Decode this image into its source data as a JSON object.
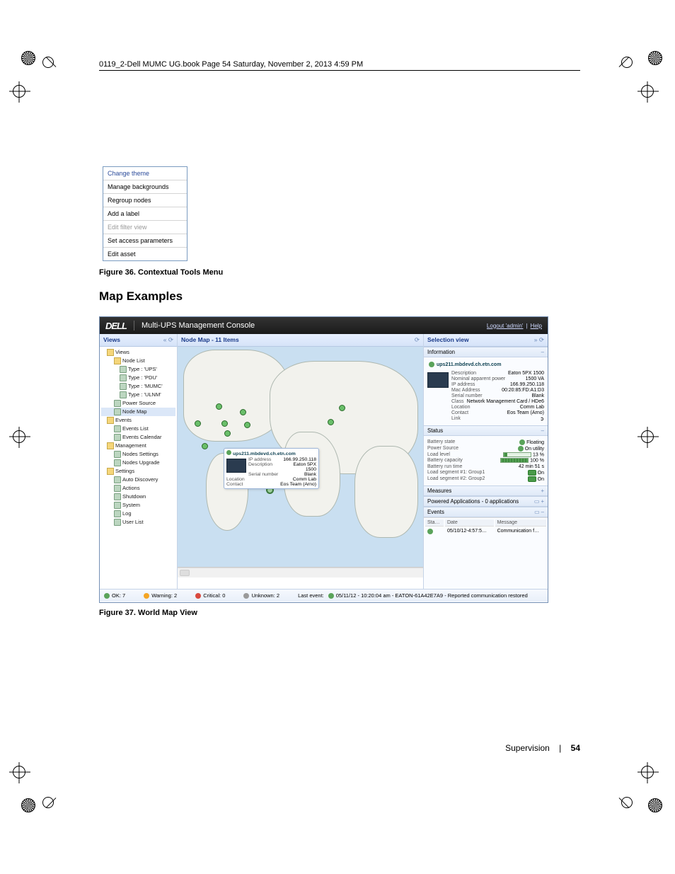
{
  "header_line": "0119_2-Dell MUMC UG.book  Page 54  Saturday, November 2, 2013  4:59 PM",
  "ctx_menu": {
    "items": [
      "Change theme",
      "Manage backgrounds",
      "Regroup nodes",
      "Add a label",
      "Edit filter view",
      "Set access parameters",
      "Edit asset"
    ],
    "caption": "Figure 36.  Contextual Tools Menu"
  },
  "heading": "Map Examples",
  "console": {
    "brand": "DELL",
    "title": "Multi-UPS Management Console",
    "logout": "Logout 'admin'",
    "help": "Help",
    "views_head": "Views",
    "tree": [
      {
        "cls": "i1 node",
        "t": "Views"
      },
      {
        "cls": "i2 node",
        "t": "Node List"
      },
      {
        "cls": "i3 leaf",
        "t": "Type : 'UPS'"
      },
      {
        "cls": "i3 leaf",
        "t": "Type : 'PDU'"
      },
      {
        "cls": "i3 leaf",
        "t": "Type : 'MUMC'"
      },
      {
        "cls": "i3 leaf",
        "t": "Type : 'ULNM'"
      },
      {
        "cls": "i2 leaf",
        "t": "Power Source"
      },
      {
        "cls": "i2 leaf sel",
        "t": "Node Map"
      },
      {
        "cls": "i1 node",
        "t": "Events"
      },
      {
        "cls": "i2 leaf",
        "t": "Events List"
      },
      {
        "cls": "i2 leaf",
        "t": "Events Calendar"
      },
      {
        "cls": "i1 node",
        "t": "Management"
      },
      {
        "cls": "i2 leaf",
        "t": "Nodes Settings"
      },
      {
        "cls": "i2 leaf",
        "t": "Nodes Upgrade"
      },
      {
        "cls": "i1 node",
        "t": "Settings"
      },
      {
        "cls": "i2 leaf",
        "t": "Auto Discovery"
      },
      {
        "cls": "i2 leaf",
        "t": "Actions"
      },
      {
        "cls": "i2 leaf",
        "t": "Shutdown"
      },
      {
        "cls": "i2 leaf",
        "t": "System"
      },
      {
        "cls": "i2 leaf",
        "t": "Log"
      },
      {
        "cls": "i2 leaf",
        "t": "User List"
      }
    ],
    "center_head": "Node Map - 11 Items",
    "popup": {
      "title": "ups211.mbdevd.ch.etn.com",
      "rows": [
        {
          "k": "IP address",
          "v": "166.99.250.118"
        },
        {
          "k": "Description",
          "v": "Eaton 5PX 1500"
        },
        {
          "k": "Serial number",
          "v": "Blank"
        },
        {
          "k": "Location",
          "v": "Comm Lab"
        },
        {
          "k": "Contact",
          "v": "Eos Team (Arno)"
        }
      ]
    },
    "selection_head": "Selection view",
    "info_head": "Information",
    "info_title": "ups211.mbdevd.ch.etn.com",
    "info_rows": [
      {
        "k": "Description",
        "v": "Eaton 5PX 1500"
      },
      {
        "k": "Nominal apparent power",
        "v": "1500 VA"
      },
      {
        "k": "IP address",
        "v": "166.99.250.118"
      },
      {
        "k": "Mac Address",
        "v": "00:20:85:FD:A1:D3"
      },
      {
        "k": "Serial number",
        "v": "Blank"
      },
      {
        "k": "Class",
        "v": "Network Management Card / HDe6"
      },
      {
        "k": "Location",
        "v": "Comm Lab"
      },
      {
        "k": "Contact",
        "v": "Eos Team (Arno)"
      },
      {
        "k": "Link",
        "v": "➲"
      }
    ],
    "status_head": "Status",
    "status_rows": [
      {
        "k": "Battery state",
        "v": "Floating",
        "icon": "dot"
      },
      {
        "k": "Power Source",
        "v": "On utility",
        "icon": "dot"
      },
      {
        "k": "Load level",
        "v": "13 %",
        "bar": 13
      },
      {
        "k": "Battery capacity",
        "v": "100 %",
        "bar": 100
      },
      {
        "k": "Battery run time",
        "v": "42 min 51 s"
      },
      {
        "k": "Load segment #1: Group1",
        "v": "On",
        "icon": "pill"
      },
      {
        "k": "Load segment #2: Group2",
        "v": "On",
        "icon": "pill"
      }
    ],
    "measures_head": "Measures",
    "powered_head": "Powered Applications - 0 applications",
    "events_head": "Events",
    "events_cols": [
      "Sta…",
      "Date",
      "Message"
    ],
    "events_row": {
      "date": "05/10/12-4:57:5…",
      "msg": "Communication f…"
    },
    "statusbar": {
      "ok": {
        "label": "OK: 7",
        "color": "#5aa35a"
      },
      "warn": {
        "label": "Warning: 2",
        "color": "#f4a524"
      },
      "crit": {
        "label": "Critical: 0",
        "color": "#d94a3f"
      },
      "unk": {
        "label": "Unknown: 2",
        "color": "#9a9a9a"
      },
      "last": "Last event:",
      "last_msg": "05/11/12 - 10:20:04 am - EATON-61A42E7A9 - Reported communication restored"
    }
  },
  "fig2_caption": "Figure 37.  World Map View",
  "footer": {
    "section": "Supervision",
    "page": "54"
  }
}
